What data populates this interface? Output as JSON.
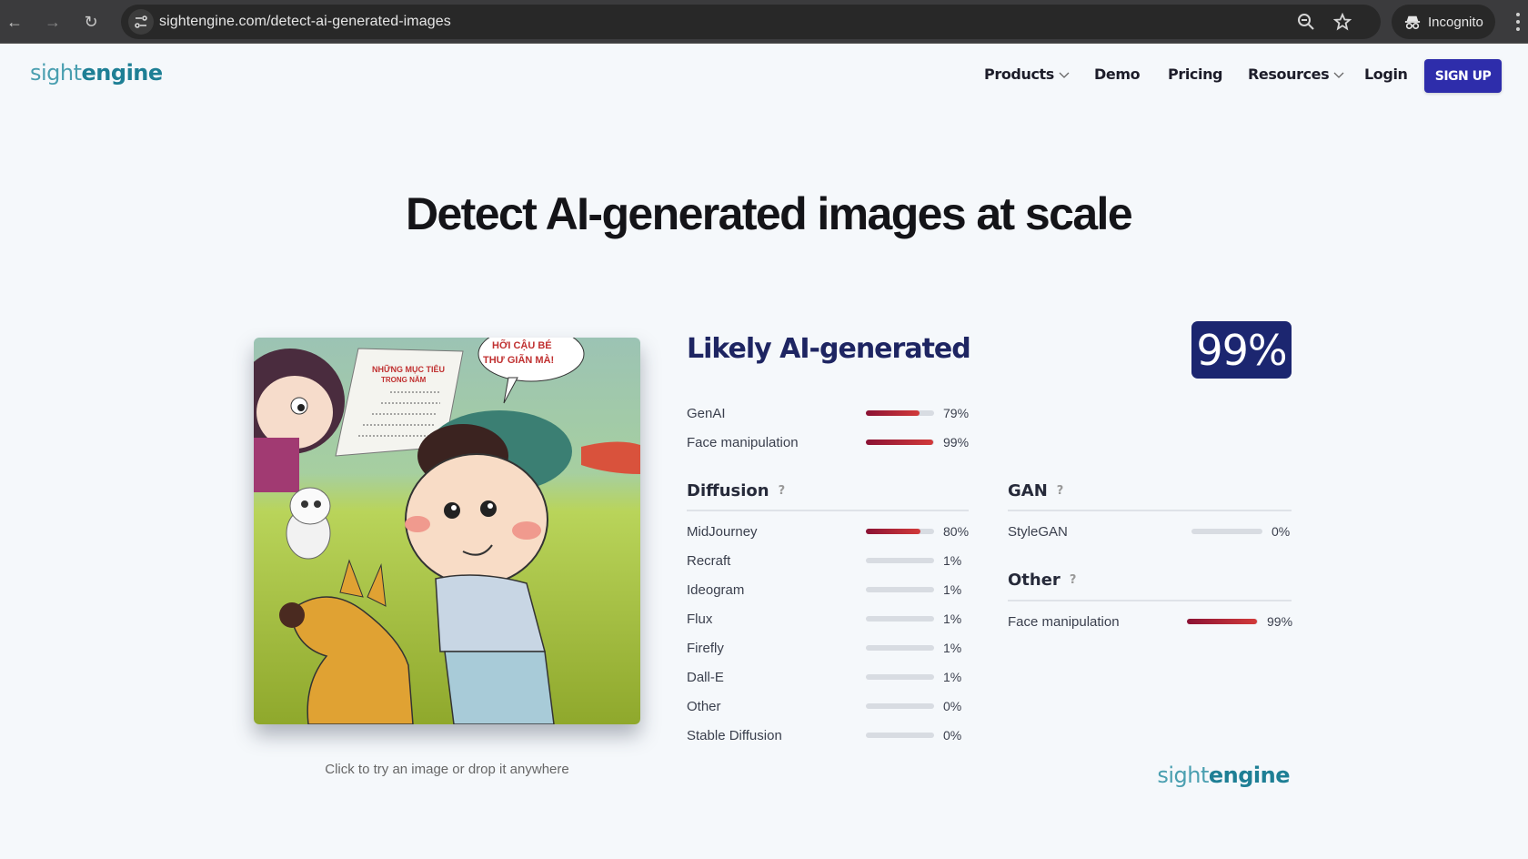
{
  "browser": {
    "url": "sightengine.com/detect-ai-generated-images",
    "profile_label": "Incognito",
    "icons": [
      "back-arrow-icon",
      "forward-arrow-icon",
      "reload-icon",
      "site-info-icon",
      "zoom-icon",
      "bookmark-star-icon",
      "incognito-icon",
      "more-menu-icon"
    ]
  },
  "header": {
    "logo": {
      "light": "sight",
      "bold": "engine"
    },
    "nav": [
      {
        "label": "Products",
        "has_dropdown": true
      },
      {
        "label": "Demo",
        "has_dropdown": false
      },
      {
        "label": "Pricing",
        "has_dropdown": false
      },
      {
        "label": "Resources",
        "has_dropdown": true
      },
      {
        "label": "Login",
        "has_dropdown": false
      }
    ],
    "signup_label": "SIGN UP",
    "colors": {
      "signup_bg": "#2e2dab",
      "logo_teal": "#1e7f95"
    }
  },
  "hero": {
    "title": "Detect AI-generated images at scale"
  },
  "demo": {
    "image_alt": "Cartoon illustration of a boy in a green beret with a dog, a cat and a girl holding a list",
    "image_texts": [
      "NHỮNG MỤC TIÊU TRONG NĂM",
      "HỠI CẬU BÉ THƯ GIÃN MÀ!"
    ],
    "caption": "Click to try an image or drop it anywhere"
  },
  "result": {
    "verdict": "Likely AI-generated",
    "score": "99%",
    "score_bg": "#1c2670",
    "summary": [
      {
        "label": "GenAI",
        "value": 79,
        "pct": "79%"
      },
      {
        "label": "Face manipulation",
        "value": 99,
        "pct": "99%"
      }
    ],
    "diffusion": {
      "title": "Diffusion",
      "help": "?",
      "items": [
        {
          "label": "MidJourney",
          "value": 80,
          "pct": "80%"
        },
        {
          "label": "Recraft",
          "value": 1,
          "pct": "1%"
        },
        {
          "label": "Ideogram",
          "value": 1,
          "pct": "1%"
        },
        {
          "label": "Flux",
          "value": 1,
          "pct": "1%"
        },
        {
          "label": "Firefly",
          "value": 1,
          "pct": "1%"
        },
        {
          "label": "Dall-E",
          "value": 1,
          "pct": "1%"
        },
        {
          "label": "Other",
          "value": 0,
          "pct": "0%"
        },
        {
          "label": "Stable Diffusion",
          "value": 0,
          "pct": "0%"
        }
      ]
    },
    "gan": {
      "title": "GAN",
      "help": "?",
      "items": [
        {
          "label": "StyleGAN",
          "value": 0,
          "pct": "0%"
        }
      ]
    },
    "other": {
      "title": "Other",
      "help": "?",
      "items": [
        {
          "label": "Face manipulation",
          "value": 99,
          "pct": "99%"
        }
      ]
    },
    "bar_colors": {
      "fill_start": "#8b1234",
      "fill_end": "#d23a3a",
      "track": "#d8dce2"
    }
  },
  "footer": {
    "logo": {
      "light": "sight",
      "bold": "engine"
    }
  }
}
